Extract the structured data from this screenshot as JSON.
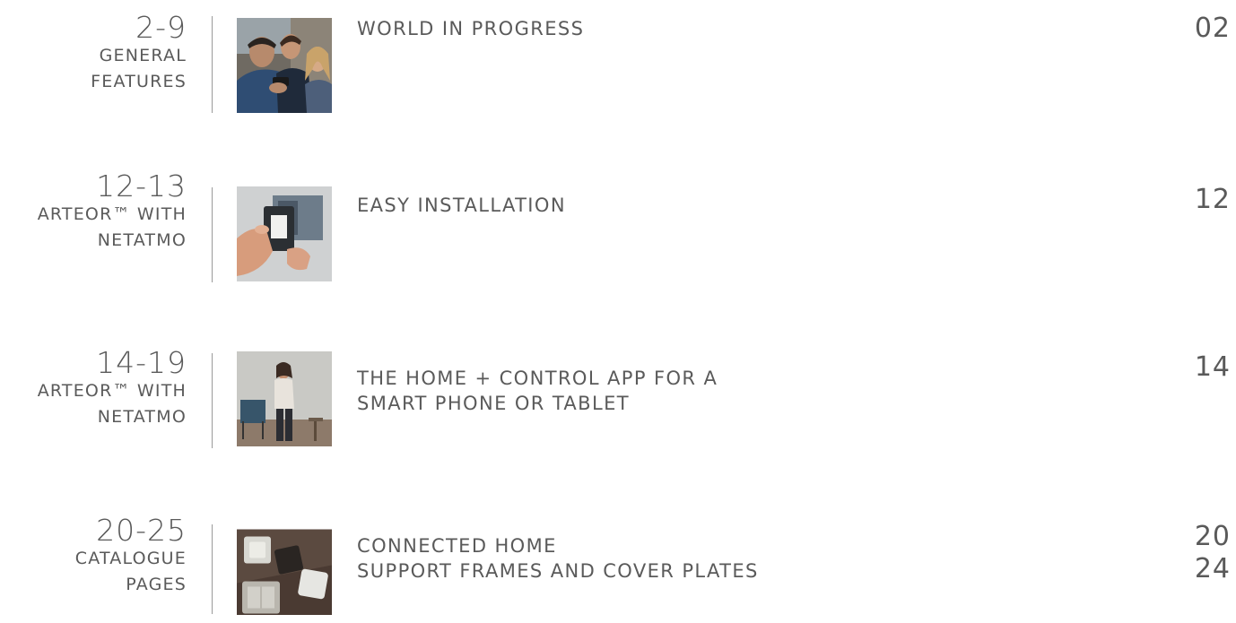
{
  "entries": [
    {
      "range": "2-9",
      "section": [
        "GENERAL",
        "FEATURES"
      ],
      "titles": [
        "WORLD IN PROGRESS"
      ],
      "pages": [
        "02"
      ],
      "thumbnail": "people-looking-at-smartphone"
    },
    {
      "range": "12-13",
      "section": [
        "ARTEOR™ WITH",
        "NETATMO"
      ],
      "titles": [
        "EASY INSTALLATION"
      ],
      "pages": [
        "12"
      ],
      "thumbnail": "hand-installing-switch-module"
    },
    {
      "range": "14-19",
      "section": [
        "ARTEOR™ WITH",
        "NETATMO"
      ],
      "titles": [
        "THE HOME + CONTROL APP FOR A",
        "SMART PHONE OR TABLET"
      ],
      "pages": [
        "14"
      ],
      "thumbnail": "woman-with-phone-in-room"
    },
    {
      "range": "20-25",
      "section": [
        "CATALOGUE",
        "PAGES"
      ],
      "titles": [
        "CONNECTED HOME",
        "SUPPORT FRAMES AND COVER PLATES"
      ],
      "pages": [
        "20",
        "24"
      ],
      "thumbnail": "switch-cover-plates"
    }
  ],
  "colors": {
    "text": "#5a5a5a",
    "divider": "#9a9a9a",
    "background": "#ffffff"
  }
}
